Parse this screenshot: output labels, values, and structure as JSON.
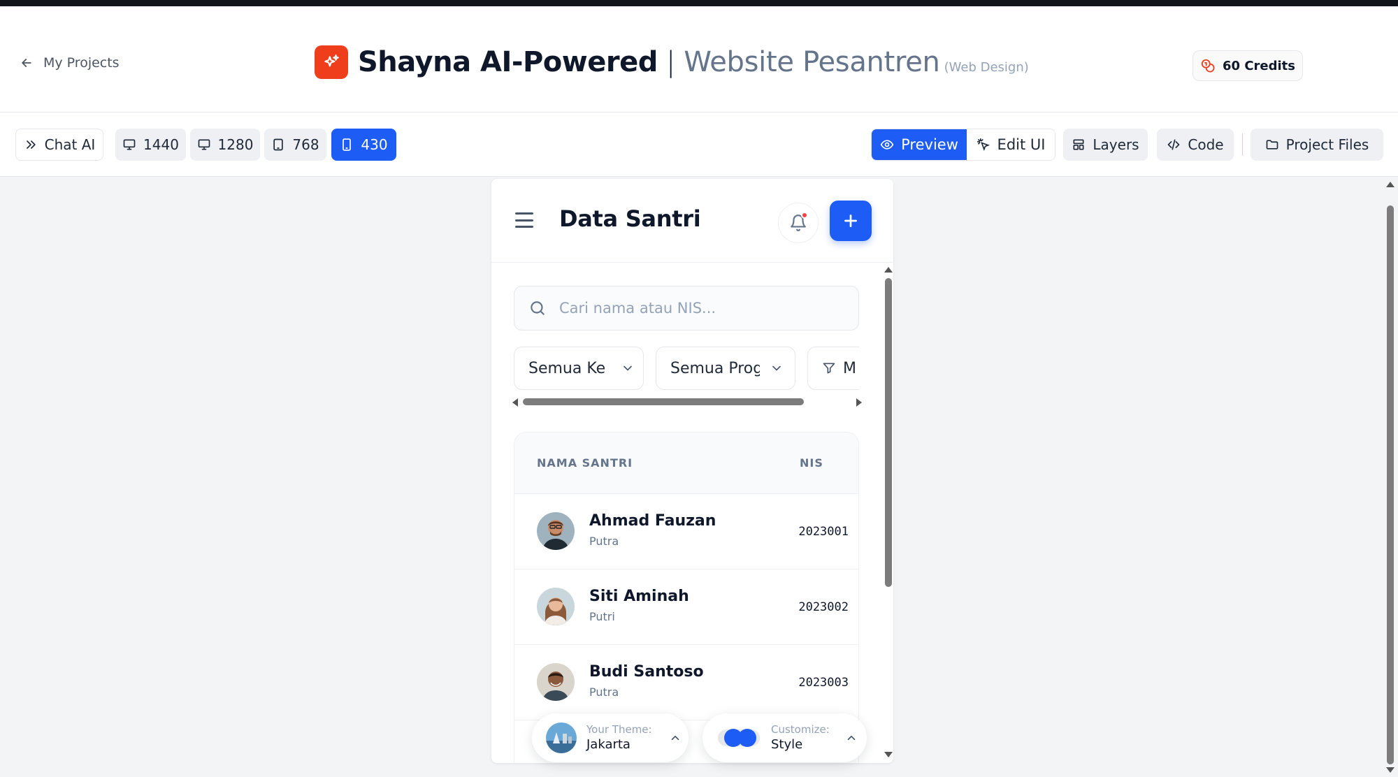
{
  "header": {
    "back_label": "My Projects",
    "app_name": "Shayna AI-Powered",
    "separator": "|",
    "project_name": "Website Pesantren",
    "project_type": "(Web Design)",
    "credits_label": "60 Credits"
  },
  "toolbar": {
    "chat_label": "Chat AI",
    "viewports": [
      "1440",
      "1280",
      "768",
      "430"
    ],
    "active_viewport": "430",
    "preview_label": "Preview",
    "edit_ui_label": "Edit UI",
    "layers_label": "Layers",
    "code_label": "Code",
    "project_files_label": "Project Files"
  },
  "phone": {
    "title": "Data Santri",
    "search_placeholder": "Cari nama atau NIS...",
    "filters": [
      "Semua Kel",
      "Semua Prog",
      "M"
    ],
    "table": {
      "headers": [
        "NAMA SANTRI",
        "NIS"
      ],
      "rows": [
        {
          "name": "Ahmad Fauzan",
          "gender": "Putra",
          "nis": "2023001"
        },
        {
          "name": "Siti Aminah",
          "gender": "Putri",
          "nis": "2023002"
        },
        {
          "name": "Budi Santoso",
          "gender": "Putra",
          "nis": "2023003"
        }
      ]
    }
  },
  "theme_pill": {
    "caption": "Your Theme:",
    "value": "Jakarta"
  },
  "customize_pill": {
    "caption": "Customize:",
    "value": "Style"
  },
  "colors": {
    "accent": "#1d5cf5",
    "logo": "#ef3e1c",
    "notification_dot": "#ef4444"
  }
}
